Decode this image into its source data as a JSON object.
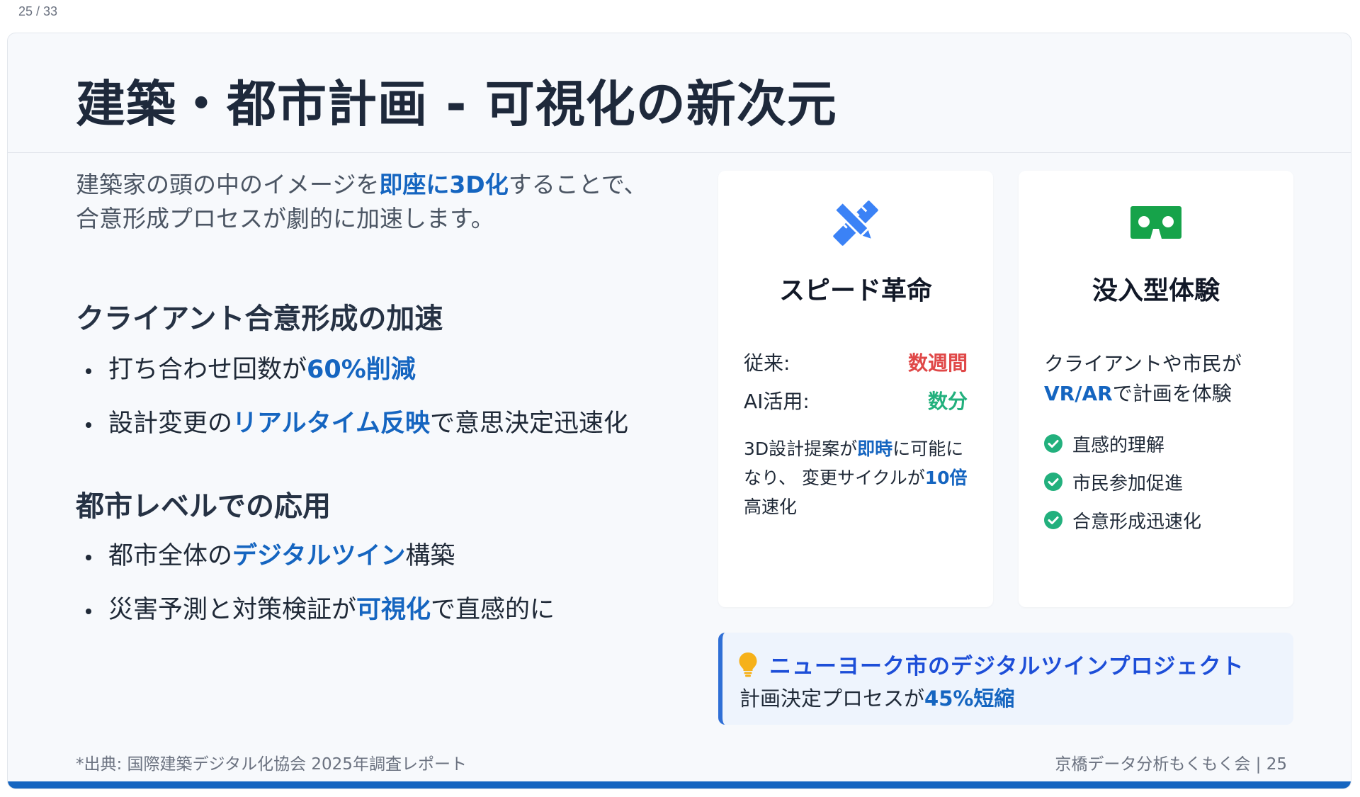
{
  "page_counter": "25 / 33",
  "slide": {
    "title": "建築・都市計画 - 可視化の新次元",
    "intro": {
      "before": "建築家の頭の中のイメージを",
      "highlight": "即座に3D化",
      "after": "することで、合意形成プロセスが劇的に加速します。"
    },
    "section1": {
      "title": "クライアント合意形成の加速",
      "bullets": [
        {
          "before": "打ち合わせ回数が",
          "highlight": "60%削減",
          "after": ""
        },
        {
          "before": "設計変更の",
          "highlight": "リアルタイム反映",
          "after": "で意思決定迅速化"
        }
      ]
    },
    "section2": {
      "title": "都市レベルでの応用",
      "bullets": [
        {
          "before": "都市全体の",
          "highlight": "デジタルツイン",
          "after": "構築"
        },
        {
          "before": "災害予測と対策検証が",
          "highlight": "可視化",
          "after": "で直感的に"
        }
      ]
    },
    "card_speed": {
      "icon": "pencil-ruler-icon",
      "title": "スピード革命",
      "row1_label": "従来:",
      "row1_value": "数週間",
      "row2_label": "AI活用:",
      "row2_value": "数分",
      "desc_1": "3D設計提案が",
      "desc_hl1": "即時",
      "desc_2": "に可能になり、 変更サイクルが",
      "desc_hl2": "10倍",
      "desc_3": "高速化"
    },
    "card_immersive": {
      "icon": "vr-goggles-icon",
      "title": "没入型体験",
      "text_1": "クライアントや市民が",
      "text_hl": "VR/AR",
      "text_2": "で計画を体験",
      "checks": [
        "直感的理解",
        "市民参加促進",
        "合意形成迅速化"
      ]
    },
    "callout": {
      "icon": "lightbulb-icon",
      "title": "ニューヨーク市のデジタルツインプロジェクト",
      "body_before": "計画決定プロセスが",
      "body_highlight": "45%短縮"
    },
    "footer": {
      "source": "*出典: 国際建築デジタル化協会 2025年調査レポート",
      "right": "京橋データ分析もくもく会 | 25"
    }
  },
  "colors": {
    "accent_blue": "#1565c0",
    "red": "#e04848",
    "green": "#22b07d",
    "icon_blue": "#3b82f6",
    "icon_green": "#16a34a"
  }
}
